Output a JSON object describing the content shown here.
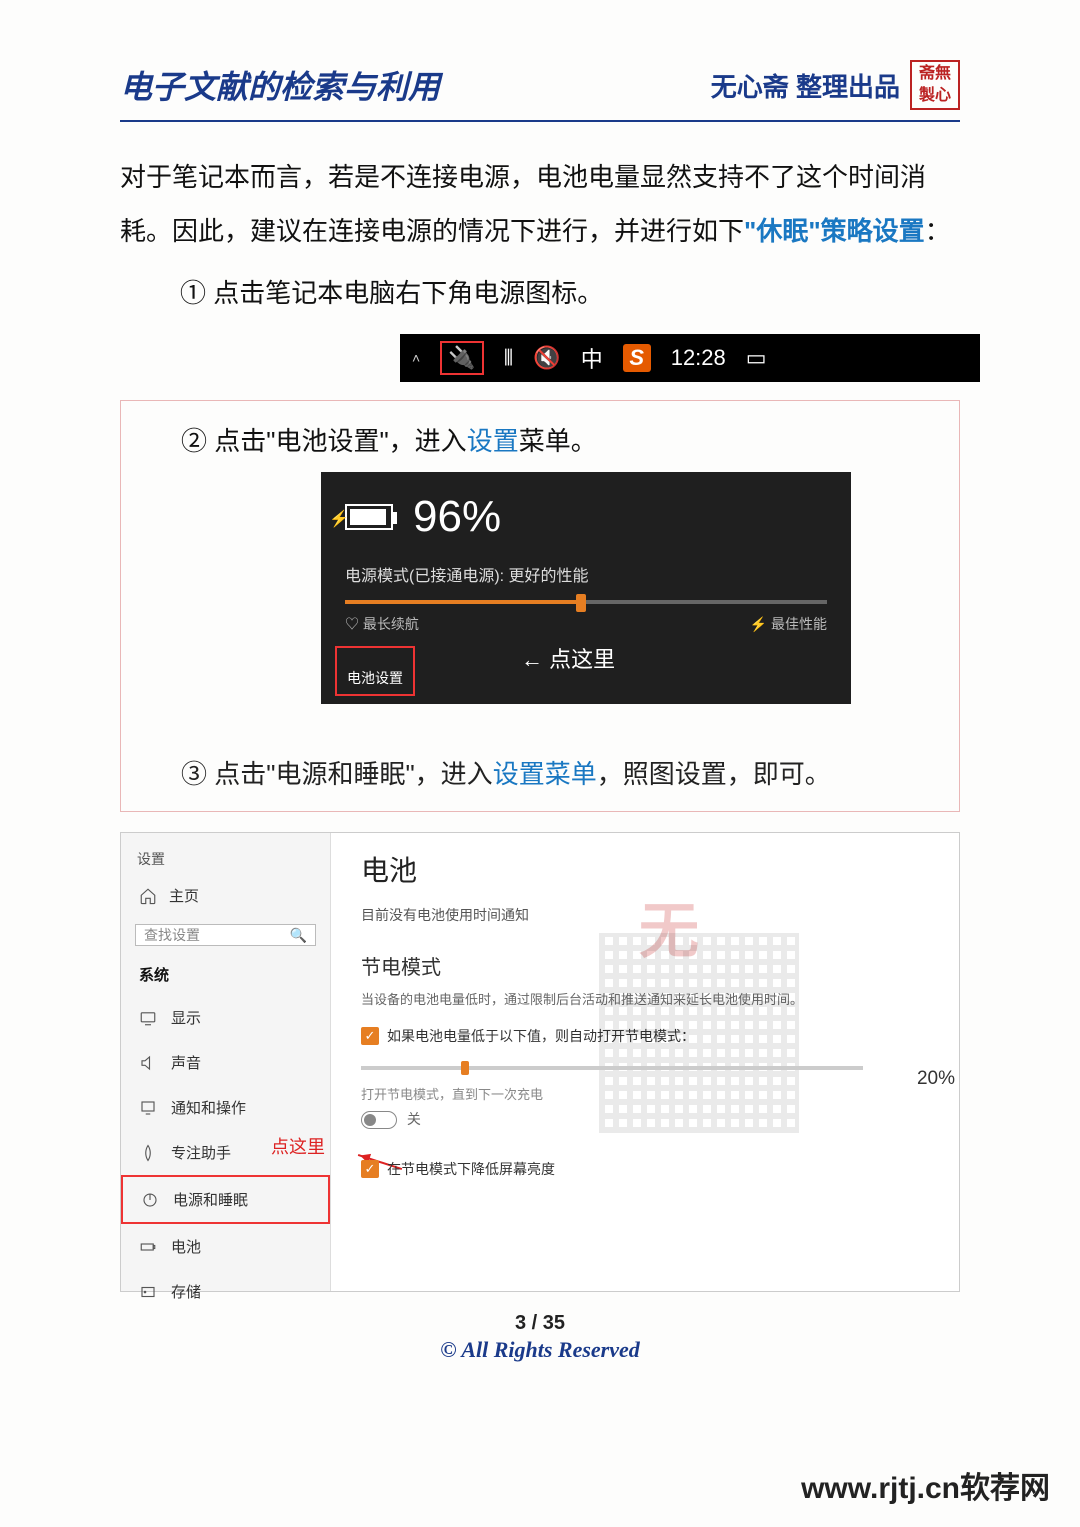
{
  "header": {
    "title": "电子文献的检索与利用",
    "subtitle": "无心斋  整理出品",
    "stamp_top": "斋無",
    "stamp_bottom": "製心"
  },
  "paragraph": {
    "p1": "对于笔记本而言，若是不连接电源，电池电量显然支持不了这个时间消耗。因此，建议在连接电源的情况下进行，并进行如下",
    "p1_hl": "\"休眠\"策略设置",
    "p1_tail": "："
  },
  "steps": {
    "s1": "① 点击笔记本电脑右下角电源图标。",
    "s2_pre": "② 点击\"电池设置\"，进入",
    "s2_hl": "设置",
    "s2_post": "菜单。",
    "s3_pre": "③ 点击\"电源和睡眠\"，进入",
    "s3_hl": "设置菜单",
    "s3_post": "，照图设置，即可。"
  },
  "taskbar": {
    "ime": "中",
    "sogou": "S",
    "time": "12:28"
  },
  "battery_popup": {
    "percent": "96%",
    "mode_label": "电源模式(已接通电源): 更好的性能",
    "left_end": "最长续航",
    "right_end": "最佳性能",
    "settings_btn": "电池设置",
    "click_here": "← 点这里"
  },
  "settings": {
    "window_title": "设置",
    "home": "主页",
    "search_placeholder": "查找设置",
    "system": "系统",
    "nav": {
      "display": "显示",
      "sound": "声音",
      "notify": "通知和操作",
      "focus": "专注助手",
      "power": "电源和睡眠",
      "battery": "电池",
      "storage": "存储"
    },
    "click_here_red": "点这里",
    "right": {
      "title": "电池",
      "line1": "目前没有电池使用时间通知",
      "sub": "节电模式",
      "desc": "当设备的电池电量低时，通过限制后台活动和推送通知来延长电池使用时间。",
      "chk1": "如果电池电量低于以下值，则自动打开节电模式：",
      "percent": "20%",
      "tgl_label": "打开节电模式，直到下一次充电",
      "tgl_state": "关",
      "chk2": "在节电模式下降低屏幕亮度"
    }
  },
  "footer": {
    "page": "3 / 35",
    "rights": "© All Rights Reserved"
  },
  "watermark_site": "www.rjtj.cn软荐网"
}
